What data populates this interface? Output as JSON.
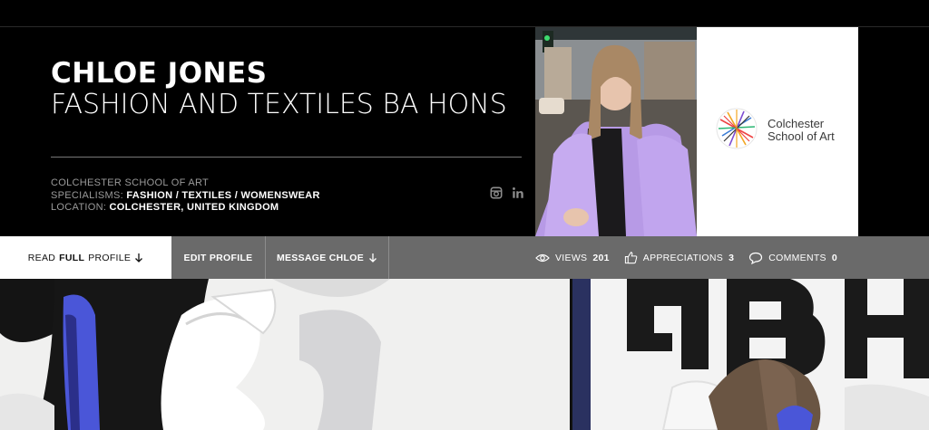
{
  "profile": {
    "name": "CHLOE JONES",
    "course": "FASHION AND TEXTILES BA HONS",
    "school": "COLCHESTER SCHOOL OF ART",
    "specialisms_label": "SPECIALISMS:",
    "specialisms": "FASHION / TEXTILES / WOMENSWEAR",
    "location_label": "LOCATION:",
    "location": "COLCHESTER, UNITED KINGDOM"
  },
  "school_card": {
    "line1": "Colchester",
    "line2": "School of Art"
  },
  "social": {
    "icons": [
      "instagram-icon",
      "linkedin-icon"
    ]
  },
  "tabs": {
    "read_prefix": "READ",
    "read_bold": "FULL",
    "read_suffix": "PROFILE",
    "edit": "EDIT PROFILE",
    "message": "MESSAGE CHLOE"
  },
  "stats": {
    "views_label": "VIEWS",
    "views": "201",
    "appreciations_label": "APPRECIATIONS",
    "appreciations": "3",
    "comments_label": "COMMENTS",
    "comments": "0"
  },
  "colors": {
    "hero_bg": "#000000",
    "tabbar_bg": "#6a6a6a",
    "meta_text": "#9a9a9a"
  }
}
